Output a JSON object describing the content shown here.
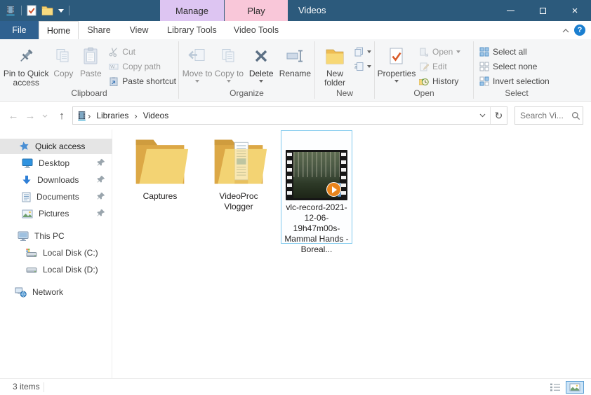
{
  "titlebar": {
    "title": "Videos",
    "contextual": {
      "manage": "Manage",
      "play": "Play"
    }
  },
  "tabs": {
    "file": "File",
    "home": "Home",
    "share": "Share",
    "view": "View",
    "library_tools": "Library Tools",
    "video_tools": "Video Tools"
  },
  "ribbon": {
    "clipboard": {
      "label": "Clipboard",
      "pin_to_quick_access": "Pin to Quick access",
      "copy": "Copy",
      "paste": "Paste",
      "cut": "Cut",
      "copy_path": "Copy path",
      "paste_shortcut": "Paste shortcut"
    },
    "organize": {
      "label": "Organize",
      "move_to": "Move to",
      "copy_to": "Copy to",
      "delete": "Delete",
      "rename": "Rename"
    },
    "new": {
      "label": "New",
      "new_folder": "New folder"
    },
    "open": {
      "label": "Open",
      "properties": "Properties",
      "open": "Open",
      "edit": "Edit",
      "history": "History"
    },
    "select": {
      "label": "Select",
      "select_all": "Select all",
      "select_none": "Select none",
      "invert_selection": "Invert selection"
    }
  },
  "address": {
    "crumbs": [
      "Libraries",
      "Videos"
    ],
    "search_placeholder": "Search Vi..."
  },
  "sidebar": {
    "items": [
      {
        "label": "Quick access",
        "selected": true
      },
      {
        "label": "Desktop",
        "pinned": true
      },
      {
        "label": "Downloads",
        "pinned": true
      },
      {
        "label": "Documents",
        "pinned": true
      },
      {
        "label": "Pictures",
        "pinned": true
      },
      {
        "label": "This PC"
      },
      {
        "label": "Local Disk (C:)"
      },
      {
        "label": "Local Disk (D:)"
      },
      {
        "label": "Network"
      }
    ]
  },
  "files": [
    {
      "name": "Captures",
      "type": "folder"
    },
    {
      "name": "VideoProc Vlogger",
      "type": "folder"
    },
    {
      "name": "vlc-record-2021-12-06-19h47m00s-Mammal Hands - Boreal...",
      "type": "video",
      "selected": true
    }
  ],
  "statusbar": {
    "item_count": "3 items"
  },
  "icons": {
    "app": "videos-library-film-strip",
    "search": "magnifier",
    "refresh": "clockwise-arrow",
    "quick_access": "blue-star",
    "pin": "pushpin",
    "folder": "yellow-folder",
    "video_overlay": "orange-play-circle"
  },
  "colors": {
    "titlebar": "#2c5a7c",
    "file_tab": "#2f6190",
    "manage_tab": "#ddc5f2",
    "play_tab": "#f9c7d9",
    "selection_border": "#7fc9ed",
    "accent": "#1b7fd0"
  }
}
